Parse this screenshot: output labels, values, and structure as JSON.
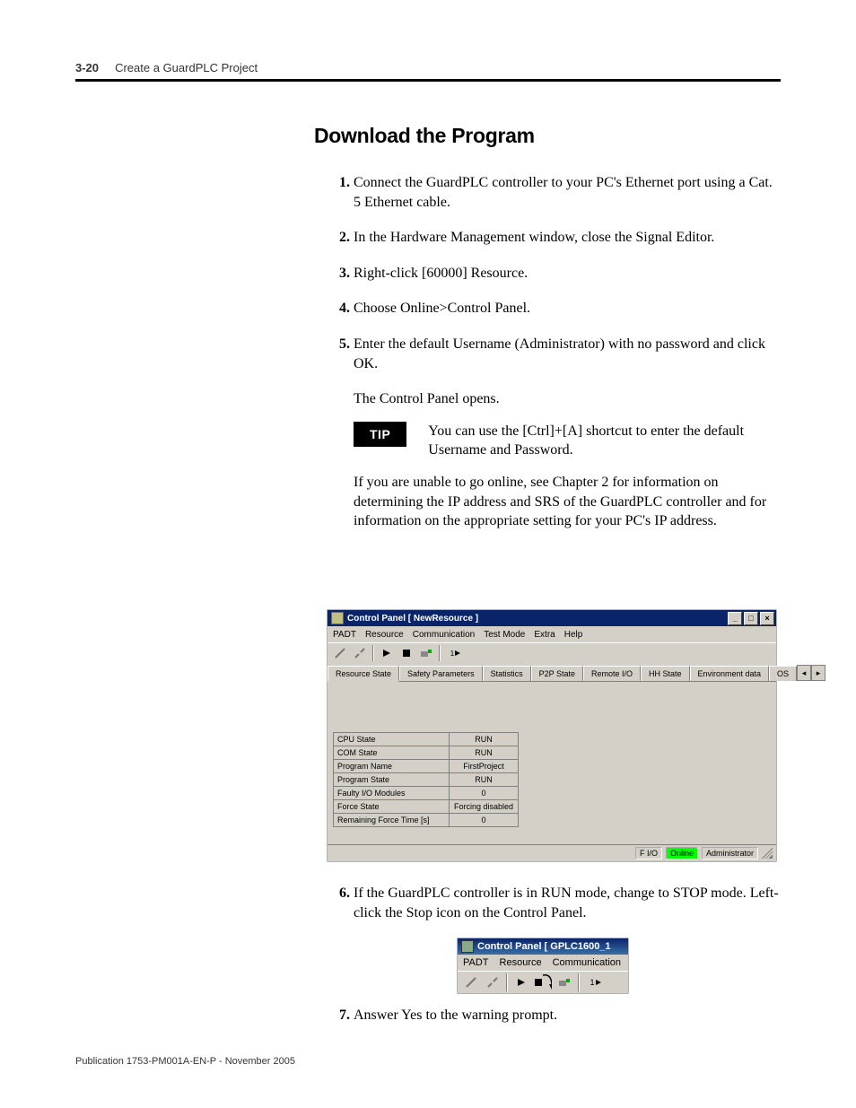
{
  "header": {
    "pageNumber": "3-20",
    "chapter": "Create a GuardPLC Project"
  },
  "section": {
    "title": "Download the Program"
  },
  "steps": {
    "s1": "Connect the GuardPLC controller to your PC's Ethernet port using a Cat. 5 Ethernet cable.",
    "s2": "In the Hardware Management window, close the Signal Editor.",
    "s3": "Right-click [60000] Resource.",
    "s4": "Choose Online>Control Panel.",
    "s5": "Enter the default Username (Administrator) with no password and click OK.",
    "s6": "If the GuardPLC controller is in RUN mode, change to STOP mode. Left-click the Stop icon on the Control Panel.",
    "s7": "Answer Yes to the warning prompt."
  },
  "body": {
    "afterStep5": "The Control Panel opens.",
    "tipLabel": "TIP",
    "tipText": "You can use the [Ctrl]+[A] shortcut to enter the default Username and Password.",
    "afterTip": "If you are unable to go online, see Chapter 2 for information on determining the IP address and SRS of the GuardPLC controller and for information on the appropriate setting for your PC's IP address."
  },
  "screenshot1": {
    "title": "Control Panel [ NewResource ]",
    "menus": [
      "PADT",
      "Resource",
      "Communication",
      "Test Mode",
      "Extra",
      "Help"
    ],
    "tabs": [
      "Resource State",
      "Safety Parameters",
      "Statistics",
      "P2P State",
      "Remote I/O",
      "HH State",
      "Environment data",
      "OS"
    ],
    "activeTab": 0,
    "table": [
      [
        "CPU State",
        "RUN"
      ],
      [
        "COM State",
        "RUN"
      ],
      [
        "Program Name",
        "FirstProject"
      ],
      [
        "Program State",
        "RUN"
      ],
      [
        "Faulty I/O Modules",
        "0"
      ],
      [
        "Force State",
        "Forcing disabled"
      ],
      [
        "Remaining Force Time [s]",
        "0"
      ]
    ],
    "status": {
      "fio": "F I/O",
      "online": "Online",
      "user": "Administrator"
    }
  },
  "screenshot2": {
    "title": "Control Panel [ GPLC1600_1",
    "menus": [
      "PADT",
      "Resource",
      "Communication"
    ],
    "stepLabel": "1"
  },
  "footer": "Publication 1753-PM001A-EN-P - November 2005"
}
